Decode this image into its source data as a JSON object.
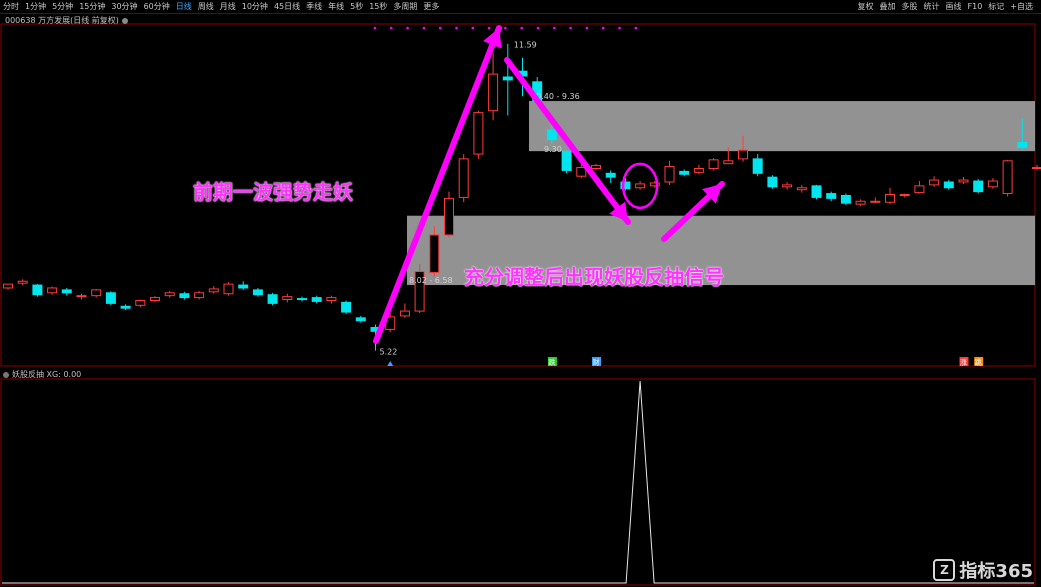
{
  "toolbar": {
    "left_items": [
      "分时",
      "1分钟",
      "5分钟",
      "15分钟",
      "30分钟",
      "60分钟",
      "日线",
      "周线",
      "月线",
      "10分钟",
      "45日线",
      "季线",
      "年线",
      "5秒",
      "15秒",
      "多周期",
      "更多"
    ],
    "active_item": "日线",
    "right_items": [
      "复权",
      "叠加",
      "多股",
      "统计",
      "画线",
      "F10",
      "标记",
      "+自选"
    ]
  },
  "stock_title": "000638 万方发展(日线 前复权)",
  "indicator_title": "妖股反抽 XG: 0.00",
  "annotations": {
    "text1": "前期一波强势走妖",
    "text2": "充分调整后出现妖股反抽信号"
  },
  "watermark": "指标365",
  "colors": {
    "up": "#ff3a3a",
    "down": "#00e5ee",
    "arrow": "#ff00ff",
    "zone": "#9a9a9a",
    "border": "#8b0000"
  },
  "chart_data": [
    {
      "type": "candlestick",
      "title": "000638 万方发展(日线 前复权)",
      "ylim": [
        4.9,
        12.0
      ],
      "labels": {
        "high": "11.59",
        "low": "5.22",
        "zone1_top": "10.40 - 9.36",
        "zone1_bottom": "9.30",
        "zone2": "8.02 - 6.58"
      },
      "zones": [
        {
          "from": 10.4,
          "to": 9.36
        },
        {
          "from": 8.02,
          "to": 6.58
        }
      ],
      "candles": [
        [
          6.52,
          6.6,
          6.58,
          6.48
        ],
        [
          6.62,
          6.66,
          6.7,
          6.58
        ],
        [
          6.58,
          6.38,
          6.6,
          6.34
        ],
        [
          6.42,
          6.52,
          6.55,
          6.38
        ],
        [
          6.48,
          6.42,
          6.52,
          6.36
        ],
        [
          6.34,
          6.36,
          6.4,
          6.28
        ],
        [
          6.36,
          6.48,
          6.5,
          6.32
        ],
        [
          6.42,
          6.2,
          6.45,
          6.16
        ],
        [
          6.14,
          6.1,
          6.18,
          6.06
        ],
        [
          6.16,
          6.26,
          6.28,
          6.12
        ],
        [
          6.26,
          6.32,
          6.35,
          6.22
        ],
        [
          6.36,
          6.42,
          6.46,
          6.32
        ],
        [
          6.4,
          6.32,
          6.44,
          6.28
        ],
        [
          6.32,
          6.42,
          6.46,
          6.28
        ],
        [
          6.44,
          6.5,
          6.56,
          6.4
        ],
        [
          6.4,
          6.6,
          6.64,
          6.36
        ],
        [
          6.58,
          6.52,
          6.66,
          6.48
        ],
        [
          6.48,
          6.38,
          6.52,
          6.34
        ],
        [
          6.38,
          6.2,
          6.42,
          6.16
        ],
        [
          6.28,
          6.34,
          6.4,
          6.22
        ],
        [
          6.3,
          6.28,
          6.34,
          6.24
        ],
        [
          6.32,
          6.24,
          6.36,
          6.2
        ],
        [
          6.26,
          6.32,
          6.36,
          6.2
        ],
        [
          6.22,
          6.02,
          6.26,
          5.98
        ],
        [
          5.9,
          5.84,
          5.94,
          5.8
        ],
        [
          5.7,
          5.62,
          5.76,
          5.22
        ],
        [
          5.66,
          5.92,
          6.0,
          5.6
        ],
        [
          5.94,
          6.04,
          6.2,
          5.9
        ],
        [
          6.04,
          6.86,
          7.02,
          6.0
        ],
        [
          6.84,
          7.62,
          7.8,
          6.76
        ],
        [
          7.62,
          8.38,
          8.52,
          7.58
        ],
        [
          8.4,
          9.2,
          9.3,
          8.3
        ],
        [
          9.3,
          10.16,
          10.2,
          9.2
        ],
        [
          10.2,
          10.96,
          11.4,
          10.0
        ],
        [
          10.9,
          10.84,
          11.59,
          10.1
        ],
        [
          11.02,
          10.92,
          11.3,
          10.5
        ],
        [
          10.8,
          10.4,
          10.9,
          10.3
        ],
        [
          9.8,
          9.6,
          9.9,
          9.5
        ],
        [
          9.36,
          8.96,
          9.36,
          8.9
        ],
        [
          8.84,
          9.02,
          9.1,
          8.8
        ],
        [
          9.0,
          9.06,
          9.1,
          8.96
        ],
        [
          8.9,
          8.82,
          8.96,
          8.7
        ],
        [
          8.72,
          8.58,
          8.8,
          8.54
        ],
        [
          8.6,
          8.68,
          8.74,
          8.56
        ],
        [
          8.64,
          8.7,
          8.74,
          8.6
        ],
        [
          8.72,
          9.04,
          9.16,
          8.66
        ],
        [
          8.94,
          8.88,
          8.98,
          8.84
        ],
        [
          8.92,
          9.0,
          9.08,
          8.88
        ],
        [
          9.0,
          9.18,
          9.22,
          8.96
        ],
        [
          9.1,
          9.16,
          9.44,
          9.1
        ],
        [
          9.2,
          9.38,
          9.68,
          9.14
        ],
        [
          9.2,
          8.9,
          9.3,
          8.84
        ],
        [
          8.82,
          8.62,
          8.86,
          8.58
        ],
        [
          8.62,
          8.66,
          8.72,
          8.56
        ],
        [
          8.56,
          8.6,
          8.66,
          8.5
        ],
        [
          8.64,
          8.4,
          8.66,
          8.36
        ],
        [
          8.48,
          8.38,
          8.52,
          8.32
        ],
        [
          8.44,
          8.28,
          8.48,
          8.24
        ],
        [
          8.26,
          8.32,
          8.36,
          8.22
        ],
        [
          8.32,
          8.32,
          8.4,
          8.28
        ],
        [
          8.3,
          8.46,
          8.6,
          8.26
        ],
        [
          8.44,
          8.46,
          8.48,
          8.4
        ],
        [
          8.5,
          8.64,
          8.74,
          8.48
        ],
        [
          8.66,
          8.76,
          8.84,
          8.62
        ],
        [
          8.72,
          8.6,
          8.76,
          8.56
        ],
        [
          8.72,
          8.76,
          8.82,
          8.68
        ],
        [
          8.74,
          8.52,
          8.78,
          8.48
        ],
        [
          8.62,
          8.74,
          8.8,
          8.58
        ],
        [
          8.48,
          9.16,
          9.18,
          8.42
        ],
        [
          9.54,
          9.44,
          10.04,
          9.4
        ],
        [
          9.0,
          9.02,
          9.08,
          8.96
        ],
        [
          9.04,
          9.04,
          9.1,
          8.98
        ],
        [
          9.04,
          8.86,
          9.1,
          8.82
        ],
        [
          8.86,
          8.8,
          8.92,
          8.76
        ]
      ],
      "markers": [
        "跌",
        "财",
        "涨",
        "跳"
      ]
    },
    {
      "type": "line",
      "title": "妖股反抽 XG: 0.00",
      "series": [
        {
          "name": "XG",
          "peak_index": 43,
          "values": "0 except 1 at the signal candle"
        }
      ],
      "ylim": [
        0,
        1
      ]
    }
  ]
}
